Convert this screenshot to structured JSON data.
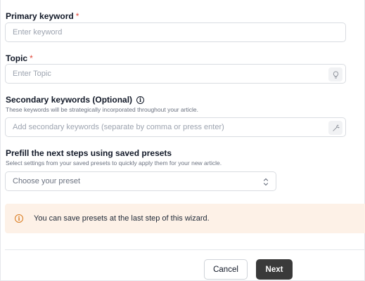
{
  "form": {
    "primary_keyword": {
      "label": "Primary keyword",
      "required_mark": "*",
      "value": "",
      "placeholder": "Enter keyword"
    },
    "topic": {
      "label": "Topic",
      "required_mark": "*",
      "value": "",
      "placeholder": "Enter Topic",
      "action_icon": "lightbulb-icon"
    },
    "secondary_keywords": {
      "label": "Secondary keywords (Optional)",
      "info_icon": "info-icon",
      "help_text": "These keywords will be strategically incorporated throughout your article.",
      "value": "",
      "placeholder": "Add secondary keywords (separate by comma or press enter)",
      "action_icon": "magic-wand-icon"
    },
    "presets": {
      "label": "Prefill the next steps using saved presets",
      "help_text": "Select settings from your saved presets to quickly apply them for your new article.",
      "selected": "Choose your preset",
      "icon": "chevron-up-down-icon"
    }
  },
  "alert": {
    "icon": "info-icon",
    "text": "You can save presets at the last step of this wizard."
  },
  "footer": {
    "cancel_label": "Cancel",
    "next_label": "Next"
  },
  "colors": {
    "required": "#e0473a",
    "alert_bg": "#fdf1e7",
    "alert_icon": "#d97a1d",
    "primary_button": "#3a3a3a"
  }
}
